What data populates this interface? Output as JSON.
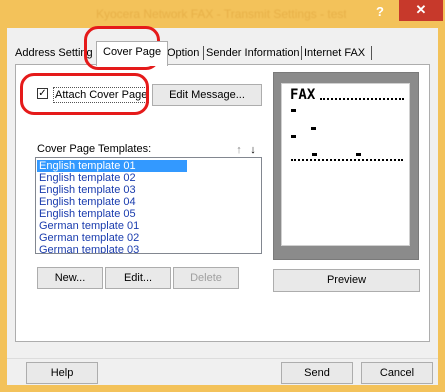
{
  "window": {
    "title": "Kyocera Network FAX - Transmit Settings - test1.pdf",
    "help_glyph": "?",
    "close_glyph": "✕"
  },
  "tabs": [
    {
      "label": "Address Setting"
    },
    {
      "label": "Cover Page"
    },
    {
      "label": "Option"
    },
    {
      "label": "Sender Information"
    },
    {
      "label": "Internet FAX"
    }
  ],
  "cover_page": {
    "attach_label": "Attach Cover Page",
    "attach_checked": true,
    "edit_message_label": "Edit Message...",
    "templates_label": "Cover Page Templates:",
    "templates": [
      "English template 01",
      "English template 02",
      "English template 03",
      "English template 04",
      "English template 05",
      "German template 01",
      "German template 02",
      "German template 03"
    ],
    "selected_index": 0,
    "move_up_icon": "↑",
    "move_down_icon": "↓",
    "new_label": "New...",
    "edit_label": "Edit...",
    "delete_label": "Delete",
    "preview_label": "Preview",
    "preview_heading": "FAX"
  },
  "footer": {
    "help_label": "Help",
    "send_label": "Send",
    "cancel_label": "Cancel"
  },
  "colors": {
    "title_bar": "#f3c25a",
    "close_button": "#c7392b",
    "selection": "#3399ff",
    "annotation": "#e51a1a"
  }
}
